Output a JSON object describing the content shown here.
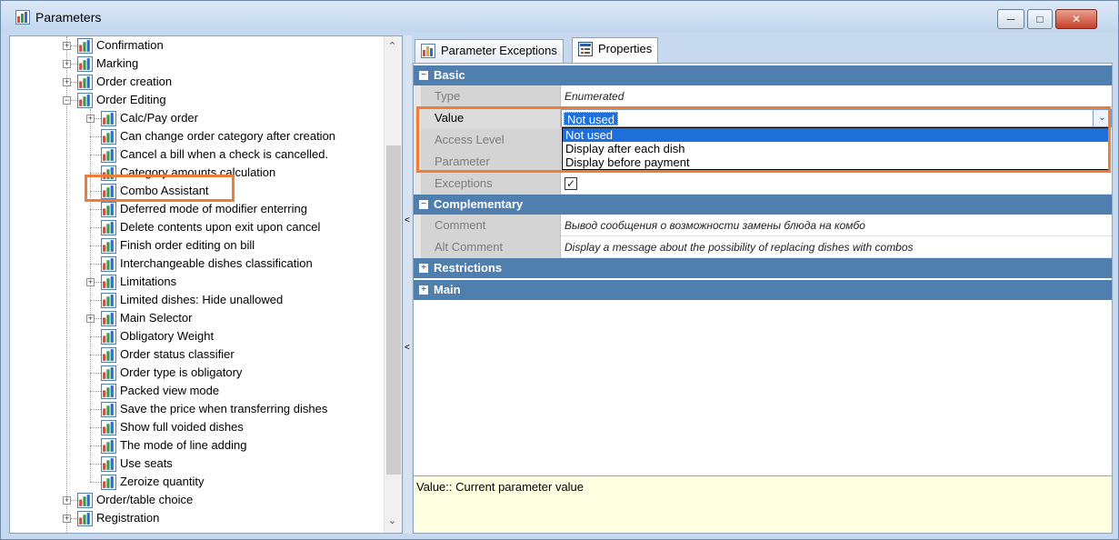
{
  "window": {
    "title": "Parameters"
  },
  "tree": {
    "items": [
      {
        "label": "Confirmation",
        "level": 1,
        "expander": "+"
      },
      {
        "label": "Marking",
        "level": 1,
        "expander": "+"
      },
      {
        "label": "Order creation",
        "level": 1,
        "expander": "+"
      },
      {
        "label": "Order Editing",
        "level": 1,
        "expander": "-"
      },
      {
        "label": "Calc/Pay order",
        "level": 2,
        "expander": "+"
      },
      {
        "label": "Can change order category after creation",
        "level": 2,
        "expander": ""
      },
      {
        "label": "Cancel a bill when a check is cancelled.",
        "level": 2,
        "expander": ""
      },
      {
        "label": "Category amounts calculation",
        "level": 2,
        "expander": ""
      },
      {
        "label": "Combo Assistant",
        "level": 2,
        "expander": "",
        "selected": true
      },
      {
        "label": "Deferred mode of modifier enterring",
        "level": 2,
        "expander": ""
      },
      {
        "label": "Delete contents upon exit upon cancel",
        "level": 2,
        "expander": ""
      },
      {
        "label": "Finish order editing on bill",
        "level": 2,
        "expander": ""
      },
      {
        "label": "Interchangeable dishes classification",
        "level": 2,
        "expander": ""
      },
      {
        "label": "Limitations",
        "level": 2,
        "expander": "+"
      },
      {
        "label": "Limited dishes: Hide unallowed",
        "level": 2,
        "expander": ""
      },
      {
        "label": "Main Selector",
        "level": 2,
        "expander": "+"
      },
      {
        "label": "Obligatory Weight",
        "level": 2,
        "expander": ""
      },
      {
        "label": "Order status classifier",
        "level": 2,
        "expander": ""
      },
      {
        "label": "Order type is obligatory",
        "level": 2,
        "expander": ""
      },
      {
        "label": "Packed view mode",
        "level": 2,
        "expander": ""
      },
      {
        "label": "Save the price when transferring dishes",
        "level": 2,
        "expander": ""
      },
      {
        "label": "Show full voided dishes",
        "level": 2,
        "expander": ""
      },
      {
        "label": "The mode of line adding",
        "level": 2,
        "expander": ""
      },
      {
        "label": "Use seats",
        "level": 2,
        "expander": ""
      },
      {
        "label": "Zeroize quantity",
        "level": 2,
        "expander": ""
      },
      {
        "label": "Order/table choice",
        "level": 1,
        "expander": "+"
      },
      {
        "label": "Registration",
        "level": 1,
        "expander": "+"
      }
    ]
  },
  "tabs": [
    {
      "label": "Parameter Exceptions"
    },
    {
      "label": "Properties"
    }
  ],
  "grid": {
    "basic_label": "Basic",
    "complementary_label": "Complementary",
    "restrictions_label": "Restrictions",
    "main_label": "Main",
    "type": {
      "name": "Type",
      "value": "Enumerated"
    },
    "value": {
      "name": "Value",
      "value": "Not used"
    },
    "access_level": {
      "name": "Access Level"
    },
    "parameter": {
      "name": "Parameter"
    },
    "exceptions": {
      "name": "Exceptions",
      "checked": true
    },
    "comment": {
      "name": "Comment",
      "value": "Вывод сообщения о возможности замены блюда на комбо"
    },
    "alt_comment": {
      "name": "Alt Comment",
      "value": "Display a message about the possibility of replacing dishes with combos"
    }
  },
  "dropdown": {
    "options": [
      "Not used",
      "Display after each dish",
      "Display before payment"
    ]
  },
  "description": {
    "text": "Value:: Current parameter value"
  },
  "colors": {
    "category_bar": "#4f7fae",
    "selection": "#1e6fd9",
    "highlight": "#ef7c37",
    "description_bg": "#ffffe1"
  }
}
